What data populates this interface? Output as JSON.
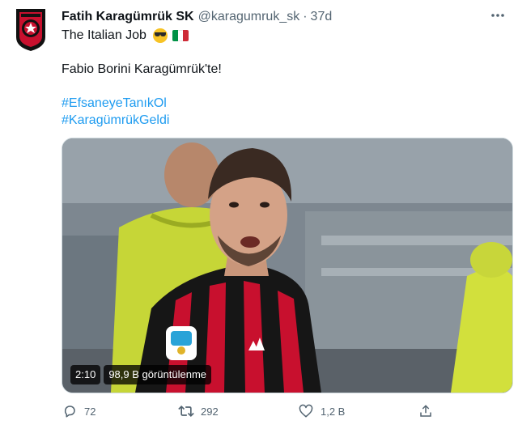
{
  "tweet": {
    "author_name": "Fatih Karagümrük SK",
    "handle": "@karagumruk_sk",
    "separator": "·",
    "time": "37d",
    "line1_text": "The Italian Job",
    "line2_text": "Fabio Borini Karagümrük'te!",
    "hashtags": [
      "#EfsaneyeTanıkOl",
      "#KaragümrükGeldi"
    ]
  },
  "media": {
    "duration": "2:10",
    "views": "98,9 B görüntülenme"
  },
  "actions": {
    "reply_count": "72",
    "retweet_count": "292",
    "like_count": "1,2 B"
  },
  "colors": {
    "link": "#1d9bf0",
    "muted": "#536471",
    "club_red": "#c8102e",
    "club_black": "#111111",
    "flag_green": "#009246",
    "flag_white": "#ffffff",
    "flag_red": "#ce2b37"
  },
  "icons": {
    "avatar": "club-crest-icon",
    "more": "more-icon",
    "sunglasses": "sunglasses-emoji-icon",
    "flag": "italy-flag-icon",
    "reply": "reply-icon",
    "retweet": "retweet-icon",
    "like": "heart-icon",
    "share": "share-icon"
  }
}
